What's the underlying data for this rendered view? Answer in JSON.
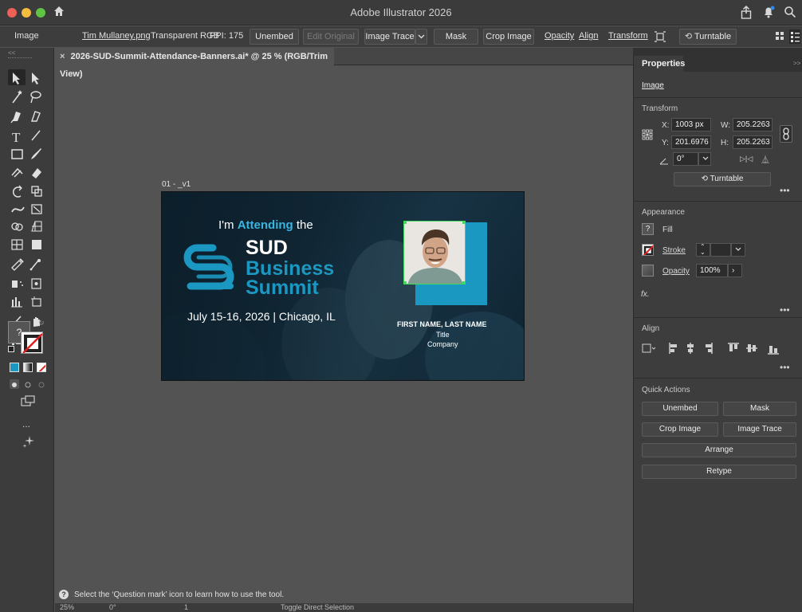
{
  "window": {
    "title": "Adobe Illustrator 2026"
  },
  "control_bar": {
    "selection_type": "Image",
    "file_name": "Tim Mullaney.png",
    "color_mode": "Transparent RGB",
    "ppi": "PPI: 175",
    "unembed": "Unembed",
    "edit_original": "Edit Original",
    "image_trace": "Image Trace",
    "mask": "Mask",
    "crop_image": "Crop Image",
    "opacity": "Opacity",
    "align": "Align",
    "transform": "Transform",
    "turntable": "Turntable"
  },
  "document": {
    "tab_title": "2026-SUD-Summit-Attendance-Banners.ai* @ 25 % (RGB/Trim View)",
    "artboard_name": "01 - _v1"
  },
  "artwork": {
    "headline_prefix": "I'm",
    "headline_highlight": "Attending",
    "headline_suffix": "the",
    "brand_line1": "SUD",
    "brand_line2": "Business",
    "brand_line3": "Summit",
    "date_location": "July 15-16, 2026 | Chicago, IL",
    "name_placeholder": "FIRST NAME, LAST NAME",
    "title_placeholder": "Title",
    "company_placeholder": "Company",
    "accent_color": "#1a98c2",
    "dark_color": "#0f2433"
  },
  "properties_panel": {
    "tab": "Properties",
    "object_type": "Image",
    "transform": {
      "heading": "Transform",
      "x_label": "X:",
      "x_value": "1003 px",
      "y_label": "Y:",
      "y_value": "201.6976",
      "w_label": "W:",
      "w_value": "205.2263",
      "h_label": "H:",
      "h_value": "205.2263",
      "rotation": "0°",
      "turntable": "Turntable"
    },
    "appearance": {
      "heading": "Appearance",
      "fill": "Fill",
      "stroke": "Stroke",
      "opacity_label": "Opacity",
      "opacity_value": "100%",
      "fx": "fx."
    },
    "align": {
      "heading": "Align"
    },
    "quick_actions": {
      "heading": "Quick Actions",
      "unembed": "Unembed",
      "mask": "Mask",
      "crop_image": "Crop Image",
      "image_trace": "Image Trace",
      "arrange": "Arrange",
      "retype": "Retype"
    }
  },
  "status": {
    "hint": "Select the ‘Question mark’ icon to learn how to use the tool.",
    "zoom": "25%",
    "rotation": "0°",
    "artboard_number": "1",
    "current_tool": "Toggle Direct Selection"
  },
  "tools": {
    "fill_stroke_question": "?",
    "more": "..."
  }
}
